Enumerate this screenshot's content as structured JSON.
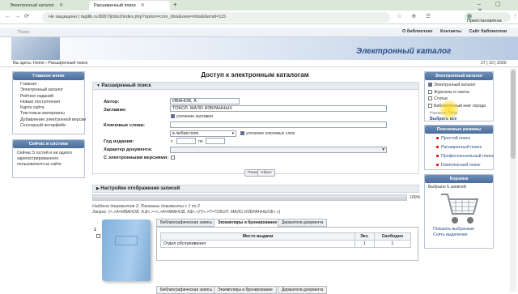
{
  "browser": {
    "tabs": [
      {
        "label": "Электронный каталог",
        "active": false
      },
      {
        "label": "Расширенный поиск",
        "active": true
      }
    ],
    "url": "Не защищено | tagilib.ru:8087/jirbis2/index.php?option=com_irbis&view=irbis&Itemid=115",
    "profile": "Приостановлена"
  },
  "site": {
    "top_left": "Поиск",
    "top_links": [
      "О библиотеке",
      "Контакты",
      "Сайт библиотеки"
    ],
    "catalog_title": "Электронный каталог",
    "breadcrumb": "Вы здесь: Home › Расширенный поиск",
    "date": "27 | 10 | 2020"
  },
  "left": {
    "menu_title": "Главное меню",
    "menu": [
      "Главная",
      "Электронный каталог",
      "Рейтинг изданий",
      "Новые поступления",
      "Карта сайта",
      "Текстовые материалы",
      "Добавление электронной версии",
      "Сенсорный интерфейс"
    ],
    "online_title": "Сейчас в системе",
    "online_text": "Сейчас 5 гостей и ни одного зарегистрированного пользователя на сайте"
  },
  "main": {
    "title": "Доступ к электронным каталогам",
    "adv_search": "Расширенный поиск",
    "author_label": "Автор:",
    "author_value": "ИВАНОВ, А.",
    "title_label": "Заглавие:",
    "title_value": "ТОБОЛ. МАЛО ИЗБРАННЫХ",
    "trunc_title": "усечение заглавия",
    "keywords_label": "Ключевые слова:",
    "in_any_field": "в любом поле",
    "trunc_keywords": "усечение ключевых слов",
    "year_label": "Год издания:",
    "from": "с",
    "to": "по",
    "doc_type_label": "Характер документа:",
    "electronic_label": "С электронными версиями:",
    "search_btn": "Поиск",
    "reset_btn": "Сброс",
    "display_settings": "Настройки отображения записей",
    "progress_pct": "100%",
    "progress_value": 1.0,
    "found": "Найдено документов 2; Показаны документы с 1 по 2",
    "query": "Запрос: (<.>A=ИВАНОВ, А.$<.>+<.>A=ИВАНОВ, А$<.>)*(<.>T=ТОБОЛ. МАЛО ИЗБРАННЫХ$<.>)",
    "record_number": "1",
    "subtabs": [
      "Библиографическая запись",
      "Экземпляры и бронирование",
      "Держатели документа"
    ],
    "table_headers": [
      "Место выдачи",
      "Экз.",
      "Свободно"
    ],
    "table_rows": [
      [
        "Отдел обслуживания",
        "1",
        "1"
      ]
    ],
    "second_subtabs": [
      "Библиографическая запись",
      "Экземпляры и бронирование",
      "Держатели документа"
    ]
  },
  "right": {
    "catalog_title": "Электронный каталог",
    "catalogs": [
      {
        "label": "Электронный каталог",
        "checked": true
      },
      {
        "label": "Журналы и газеты",
        "checked": false
      },
      {
        "label": "Статьи",
        "checked": false
      },
      {
        "label": "Библиотечный книг города",
        "checked": false
      }
    ],
    "catalog_hint": "Нажмите Тайм",
    "select_all": "Выбрать все",
    "modes_title": "Поисковые режимы",
    "modes": [
      "Простой поиск",
      "Расширенный поиск",
      "Профессиональный поиск",
      "Комплексный поиск"
    ],
    "cart_title": "Корзина",
    "cart_count": "Выбрано 5 записей",
    "cart_show": "Показать выбранные",
    "cart_clear": "Снять выделение"
  },
  "colors": {
    "accent": "#4a6d9c",
    "title": "#2a4f8a",
    "bullet": "#dd2222"
  }
}
